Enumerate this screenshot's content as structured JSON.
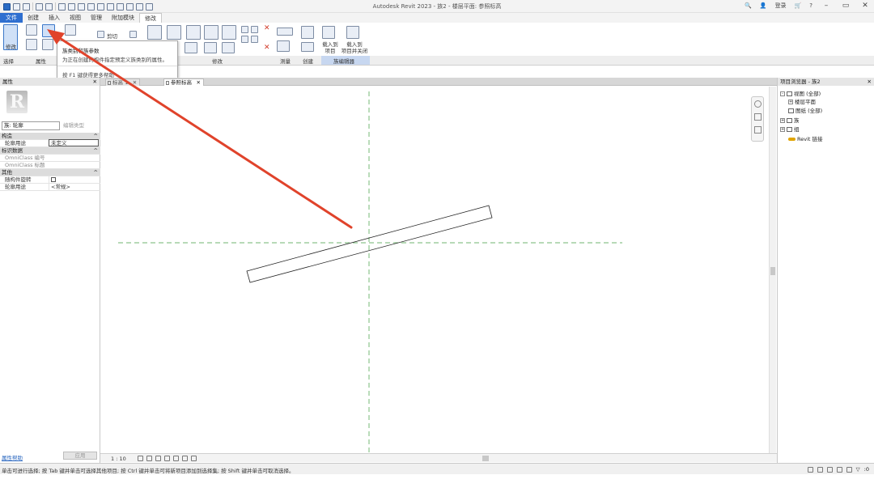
{
  "window": {
    "title": "Autodesk Revit 2023 - 族2 - 楼层平面: 参照标高",
    "sign_in": "登录",
    "help": "?"
  },
  "menu": {
    "tabs": [
      "文件",
      "创建",
      "插入",
      "视图",
      "管理",
      "附加模块",
      "修改"
    ],
    "active_tab": "修改"
  },
  "ribbon": {
    "modify_label": "修改",
    "select_label": "选择",
    "properties_label": "属性",
    "clipboard_cut": "剪切",
    "modify_group_label": "修改",
    "measure_label": "测量",
    "create_label": "创建",
    "family_editor_label": "族编辑器",
    "load_into_project": "载入到\n项目",
    "load_into_project_close": "载入到\n项目并关闭"
  },
  "tooltip": {
    "title": "族类别和族参数",
    "description": "为正在创建的构件指定预定义族类别的属性。",
    "help": "按 F1 键获得更多帮助"
  },
  "properties": {
    "header": "属性",
    "family_selector": "族: 轮廓",
    "edit_type": "编辑类型",
    "rows": [
      {
        "type": "category",
        "label": "构造"
      },
      {
        "type": "field",
        "key": "轮廓用途",
        "value": "未定义",
        "boxed": true
      },
      {
        "type": "category",
        "label": "标识数据"
      },
      {
        "type": "field",
        "key": "OmniClass 编号",
        "value": "",
        "dim": false
      },
      {
        "type": "field",
        "key": "OmniClass 标题",
        "value": "",
        "dim": true
      },
      {
        "type": "category",
        "label": "其他"
      },
      {
        "type": "field",
        "key": "随构件旋转",
        "value": "",
        "checkbox": true
      },
      {
        "type": "field",
        "key": "轮廓用途",
        "value": "<常规>"
      }
    ],
    "help_link": "属性帮助",
    "apply": "应用"
  },
  "view_tabs": [
    {
      "label": "标高 1",
      "active": false
    },
    {
      "label": "参照标高",
      "active": true
    }
  ],
  "view_control": {
    "scale": "1 : 10"
  },
  "project_browser": {
    "header": "项目浏览器 - 族2",
    "items": [
      {
        "label": "视图 (全部)",
        "level": 0,
        "expander": "-",
        "icon": "views"
      },
      {
        "label": "楼层平面",
        "level": 1,
        "expander": "+",
        "icon": ""
      },
      {
        "label": "图纸 (全部)",
        "level": 0,
        "expander": "",
        "icon": "sheets"
      },
      {
        "label": "族",
        "level": 0,
        "expander": "+",
        "icon": "family"
      },
      {
        "label": "组",
        "level": 0,
        "expander": "+",
        "icon": "group"
      },
      {
        "label": "Revit 链接",
        "level": 0,
        "expander": "",
        "icon": "link"
      }
    ]
  },
  "status": {
    "message": "单击可进行选择; 按 Tab 键并单击可选择其他项目; 按 Ctrl 键并单击可将新项目添加到选择集; 按 Shift 键并单击可取消选择。",
    "filter_count": ":0"
  },
  "colors": {
    "accent": "#2f6fd0",
    "annotation_arrow": "#e0432b",
    "reference_plane": "#7fbf7f"
  }
}
